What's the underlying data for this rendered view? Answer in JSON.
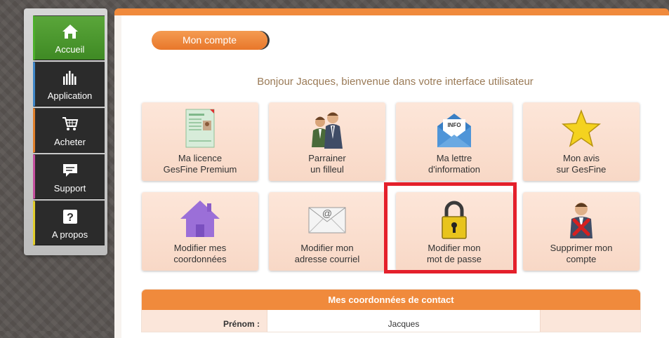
{
  "sidebar": {
    "items": [
      {
        "label": "Accueil",
        "icon": "home-icon"
      },
      {
        "label": "Application",
        "icon": "bars-icon"
      },
      {
        "label": "Acheter",
        "icon": "cart-icon"
      },
      {
        "label": "Support",
        "icon": "chat-icon"
      },
      {
        "label": "A propos",
        "icon": "question-icon"
      }
    ]
  },
  "page": {
    "tab_label": "Mon compte",
    "welcome": "Bonjour Jacques, bienvenue dans votre interface utilisateur"
  },
  "tiles": [
    {
      "line1": "Ma licence",
      "line2": "GesFine Premium",
      "icon": "license-certificate-icon"
    },
    {
      "line1": "Parrainer",
      "line2": "un filleul",
      "icon": "sponsor-people-icon"
    },
    {
      "line1": "Ma lettre",
      "line2": "d'information",
      "icon": "newsletter-envelope-icon"
    },
    {
      "line1": "Mon avis",
      "line2": "sur GesFine",
      "icon": "star-icon"
    },
    {
      "line1": "Modifier mes",
      "line2": "coordonnées",
      "icon": "house-icon"
    },
    {
      "line1": "Modifier mon",
      "line2": "adresse courriel",
      "icon": "email-envelope-icon"
    },
    {
      "line1": "Modifier mon",
      "line2": "mot de passe",
      "icon": "padlock-icon"
    },
    {
      "line1": "Supprimer mon",
      "line2": "compte",
      "icon": "delete-user-icon"
    }
  ],
  "contact": {
    "title": "Mes coordonnées de contact",
    "rows": [
      {
        "label": "Prénom :",
        "value": "Jacques"
      }
    ]
  },
  "colors": {
    "accent": "#f08a3c",
    "active_nav": "#4f9d30",
    "highlight": "#e4202b"
  }
}
